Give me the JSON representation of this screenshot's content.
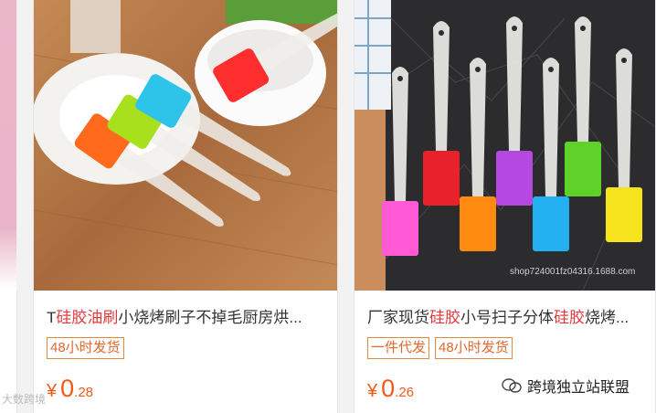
{
  "products": [
    {
      "title_parts": [
        {
          "text": "T",
          "hl": false
        },
        {
          "text": "硅胶油刷",
          "hl": true
        },
        {
          "text": "小烧烤刷子不掉毛厨房烘...",
          "hl": false
        }
      ],
      "badges": [
        "48小时发货"
      ],
      "price": {
        "yen": "¥",
        "int": "0",
        "dec": ".28"
      },
      "brush_colors": [
        "#ff6a1c",
        "#a8e01e",
        "#2ec4ea",
        "#ff2e2e"
      ]
    },
    {
      "title_parts": [
        {
          "text": "厂家现货",
          "hl": false
        },
        {
          "text": "硅胶",
          "hl": true
        },
        {
          "text": "小号扫子分体",
          "hl": false
        },
        {
          "text": "硅胶",
          "hl": true
        },
        {
          "text": "烧烤...",
          "hl": false
        }
      ],
      "badges": [
        "一件代发",
        "48小时发货"
      ],
      "price": {
        "yen": "¥",
        "int": "0",
        "dec": ".26"
      },
      "brush_colors": [
        "#ff59d6",
        "#e8212b",
        "#ff8a10",
        "#b548e0",
        "#23b0f0",
        "#5fd22a",
        "#f5e31e"
      ],
      "image_watermark": "shop724001fz04316.1688.com"
    }
  ],
  "overlay": {
    "wechat_label": "跨境独立站联盟",
    "left_mark": "大数跨境"
  }
}
